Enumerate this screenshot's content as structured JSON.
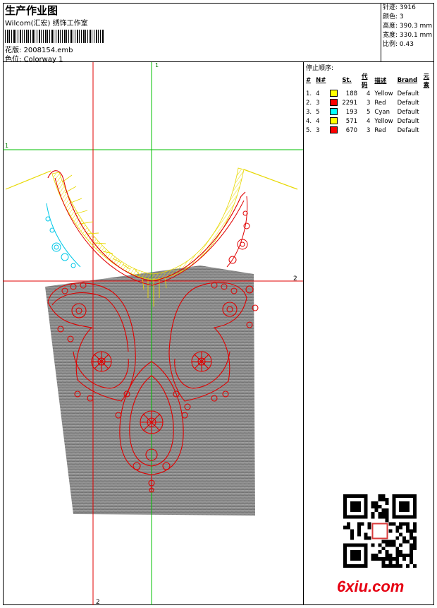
{
  "header": {
    "title": "生产作业图",
    "company": "Wilcom(汇宏) 绣饰工作室",
    "design_label": "花版:",
    "design_value": "2008154.emb",
    "colorway_label": "色位:",
    "colorway_value": "Colorway 1"
  },
  "stats": [
    {
      "label": "针迹:",
      "value": "3916"
    },
    {
      "label": "颜色:",
      "value": "3"
    },
    {
      "label": "高度:",
      "value": "390.3 mm"
    },
    {
      "label": "宽度:",
      "value": "330.1 mm"
    },
    {
      "label": "比例:",
      "value": "0.43"
    }
  ],
  "stop_sequence": {
    "title": "停止顺序:",
    "columns": [
      "#",
      "N#",
      "St.",
      "代码",
      "描述",
      "Brand",
      "元素"
    ],
    "rows": [
      {
        "num": "1.",
        "n": "4",
        "color": "#FFFF00",
        "st": "188",
        "code": "4",
        "desc": "Yellow",
        "brand": "Default"
      },
      {
        "num": "2.",
        "n": "3",
        "color": "#FF0000",
        "st": "2291",
        "code": "3",
        "desc": "Red",
        "brand": "Default"
      },
      {
        "num": "3.",
        "n": "5",
        "color": "#00FFFF",
        "st": "193",
        "code": "5",
        "desc": "Cyan",
        "brand": "Default"
      },
      {
        "num": "4.",
        "n": "4",
        "color": "#FFFF00",
        "st": "571",
        "code": "4",
        "desc": "Yellow",
        "brand": "Default"
      },
      {
        "num": "5.",
        "n": "3",
        "color": "#FF0000",
        "st": "670",
        "code": "3",
        "desc": "Red",
        "brand": "Default"
      }
    ]
  },
  "guides": {
    "green_top_label": "1",
    "green_left_label": "1",
    "red_right_label": "2",
    "red_bottom_label": "2"
  },
  "colors": {
    "guide_green": "#00C000",
    "guide_red": "#E00000",
    "stitch_red": "#E00000",
    "stitch_yellow": "#E8D800",
    "stitch_cyan": "#00C8E8",
    "fabric": "#8a8a8a"
  },
  "watermark": {
    "text": "6xiu.com"
  }
}
